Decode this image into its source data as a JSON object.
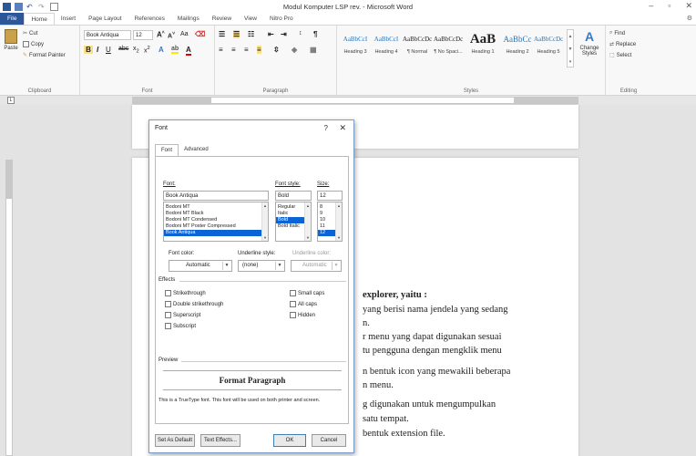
{
  "window": {
    "title": "Modul Komputer LSP rev. - Microsoft Word",
    "controls": [
      "–",
      "▫",
      "✕"
    ]
  },
  "tabs": [
    "File",
    "Home",
    "Insert",
    "Page Layout",
    "References",
    "Mailings",
    "Review",
    "View",
    "Nitro Pro"
  ],
  "ribbon": {
    "clipboard": {
      "paste": "Paste",
      "cut": "Cut",
      "copy": "Copy",
      "format_painter": "Format Painter",
      "label": "Clipboard"
    },
    "font": {
      "name": "Book Antiqua",
      "size": "12",
      "label": "Font"
    },
    "paragraph": {
      "label": "Paragraph"
    },
    "styles": {
      "items": [
        {
          "preview": "AaBbCcI",
          "name": "Heading 3"
        },
        {
          "preview": "AaBbCcI",
          "name": "Heading 4"
        },
        {
          "preview": "AaBbCcDc",
          "name": "¶ Normal"
        },
        {
          "preview": "AaBbCcDc",
          "name": "¶ No Spaci..."
        },
        {
          "preview": "AaB",
          "name": "Heading 1"
        },
        {
          "preview": "AaBbCc",
          "name": "Heading 2"
        },
        {
          "preview": "AaBbCcDc",
          "name": "Heading 5"
        }
      ],
      "change_styles": "Change Styles",
      "label": "Styles"
    },
    "editing": {
      "find": "Find",
      "replace": "Replace",
      "select": "Select",
      "label": "Editing"
    }
  },
  "document": {
    "lines": [
      "explorer, yaitu :",
      "yang berisi nama jendela yang sedang",
      "n.",
      "r menu yang dapat digunakan sesuai",
      "tu pengguna dengan mengklik menu",
      "n bentuk icon yang mewakili beberapa",
      "n menu.",
      "g digunakan untuk mengumpulkan",
      "satu tempat.",
      "bentuk extension file."
    ]
  },
  "dialog": {
    "title": "Font",
    "help": "?",
    "close": "✕",
    "tabs": [
      "Font",
      "Advanced"
    ],
    "font_label": "Font:",
    "font_value": "Book Antiqua",
    "font_list": [
      "Bodoni MT",
      "Bodoni MT Black",
      "Bodoni MT Condensed",
      "Bodoni MT Poster Compressed",
      "Book Antiqua"
    ],
    "style_label": "Font style:",
    "style_value": "Bold",
    "style_list": [
      "Regular",
      "Italic",
      "Bold",
      "Bold Italic"
    ],
    "size_label": "Size:",
    "size_value": "12",
    "size_list": [
      "8",
      "9",
      "10",
      "11",
      "12"
    ],
    "font_color_label": "Font color:",
    "font_color_value": "Automatic",
    "underline_style_label": "Underline style:",
    "underline_style_value": "(none)",
    "underline_color_label": "Underline color:",
    "underline_color_value": "Automatic",
    "effects_label": "Effects",
    "effects_left": [
      "Strikethrough",
      "Double strikethrough",
      "Superscript",
      "Subscript"
    ],
    "effects_right": [
      "Small caps",
      "All caps",
      "Hidden"
    ],
    "preview_label": "Preview",
    "preview_text": "Format Paragraph",
    "note": "This is a TrueType font. This font will be used on both printer and screen.",
    "buttons": {
      "default": "Set As Default",
      "effects": "Text Effects...",
      "ok": "OK",
      "cancel": "Cancel"
    }
  }
}
